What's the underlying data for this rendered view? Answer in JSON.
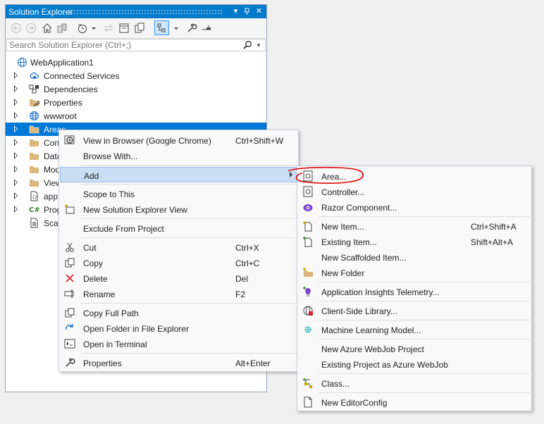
{
  "panel": {
    "title": "Solution Explorer",
    "search_placeholder": "Search Solution Explorer (Ctrl+;)"
  },
  "toolbar": {
    "icons": [
      "back-arrow-icon",
      "forward-arrow-icon",
      "home-icon",
      "switch-views-icon",
      "pending-changes-filter-icon",
      "sync-icon",
      "collapse-all-icon",
      "show-all-files-icon",
      "preview-selected-icon",
      "properties-wrench-icon",
      "preview-icon"
    ]
  },
  "tree": {
    "root": "WebApplication1",
    "items": [
      {
        "label": "Connected Services"
      },
      {
        "label": "Dependencies"
      },
      {
        "label": "Properties"
      },
      {
        "label": "wwwroot"
      },
      {
        "label": "Areas"
      },
      {
        "label": "Con"
      },
      {
        "label": "Data"
      },
      {
        "label": "Mod"
      },
      {
        "label": "View"
      },
      {
        "label": "app"
      },
      {
        "label": "Prog"
      },
      {
        "label": "Scaf"
      }
    ]
  },
  "context_menu": {
    "items": [
      {
        "label": "View in Browser (Google Chrome)",
        "shortcut": "Ctrl+Shift+W"
      },
      {
        "label": "Browse With...",
        "shortcut": ""
      },
      {
        "label": "Add",
        "shortcut": ""
      },
      {
        "label": "Scope to This",
        "shortcut": ""
      },
      {
        "label": "New Solution Explorer View",
        "shortcut": ""
      },
      {
        "label": "Exclude From Project",
        "shortcut": ""
      },
      {
        "label": "Cut",
        "shortcut": "Ctrl+X"
      },
      {
        "label": "Copy",
        "shortcut": "Ctrl+C"
      },
      {
        "label": "Delete",
        "shortcut": "Del"
      },
      {
        "label": "Rename",
        "shortcut": "F2"
      },
      {
        "label": "Copy Full Path",
        "shortcut": ""
      },
      {
        "label": "Open Folder in File Explorer",
        "shortcut": ""
      },
      {
        "label": "Open in Terminal",
        "shortcut": ""
      },
      {
        "label": "Properties",
        "shortcut": "Alt+Enter"
      }
    ]
  },
  "add_submenu": {
    "items": [
      {
        "label": "Area...",
        "shortcut": ""
      },
      {
        "label": "Controller...",
        "shortcut": ""
      },
      {
        "label": "Razor Component...",
        "shortcut": ""
      },
      {
        "label": "New Item...",
        "shortcut": "Ctrl+Shift+A"
      },
      {
        "label": "Existing Item...",
        "shortcut": "Shift+Alt+A"
      },
      {
        "label": "New Scaffolded Item...",
        "shortcut": ""
      },
      {
        "label": "New Folder",
        "shortcut": ""
      },
      {
        "label": "Application Insights Telemetry...",
        "shortcut": ""
      },
      {
        "label": "Client-Side Library...",
        "shortcut": ""
      },
      {
        "label": "Machine Learning Model...",
        "shortcut": ""
      },
      {
        "label": "New Azure WebJob Project",
        "shortcut": ""
      },
      {
        "label": "Existing Project as Azure WebJob",
        "shortcut": ""
      },
      {
        "label": "Class...",
        "shortcut": ""
      },
      {
        "label": "New EditorConfig",
        "shortcut": ""
      }
    ]
  },
  "colors": {
    "accent": "#007acc",
    "selection": "#0078d7",
    "menu_highlight": "#c9def5",
    "annotation": "#e00000"
  }
}
